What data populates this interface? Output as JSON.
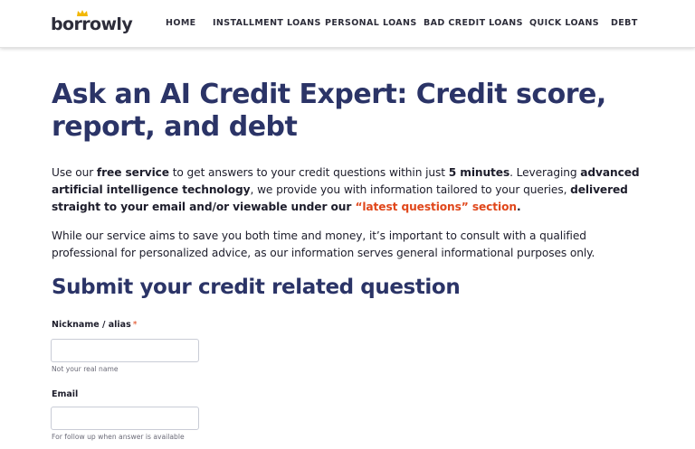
{
  "brand": {
    "name": "borrowly",
    "crown_color": "#f2b705",
    "crown_icon": "crown-icon"
  },
  "nav": {
    "items": [
      {
        "label": "HOME"
      },
      {
        "label": "INSTALLMENT LOANS"
      },
      {
        "label": "PERSONAL LOANS"
      },
      {
        "label": "BAD CREDIT LOANS"
      },
      {
        "label": "QUICK LOANS"
      },
      {
        "label": "DEBT"
      }
    ]
  },
  "main": {
    "title": "Ask an AI Credit Expert: Credit score, report, and debt",
    "intro": {
      "t1": "Use our ",
      "b1": "free service",
      "t2": " to get answers to your credit questions within just ",
      "b2": "5 minutes",
      "t3": ". Leveraging ",
      "b3": "advanced artificial intelligence technology",
      "t4": ", we provide you with information tailored to your queries, ",
      "b4": "delivered straight to your email and/or viewable under our ",
      "link": "“latest questions” section",
      "end": "."
    },
    "disclaimer": "While our service aims to save you both time and money, it’s important to consult with a qualified professional for personalized advice, as our information serves general informational purposes only.",
    "form_title": "Submit your credit related question"
  },
  "form": {
    "nickname": {
      "label": "Nickname / alias",
      "required_mark": "*",
      "value": "",
      "help": "Not your real name"
    },
    "email": {
      "label": "Email",
      "value": "",
      "help": "For follow up when answer is available"
    }
  },
  "colors": {
    "heading": "#2b3467",
    "accent": "#e0461a",
    "text": "#1d1d2b"
  }
}
